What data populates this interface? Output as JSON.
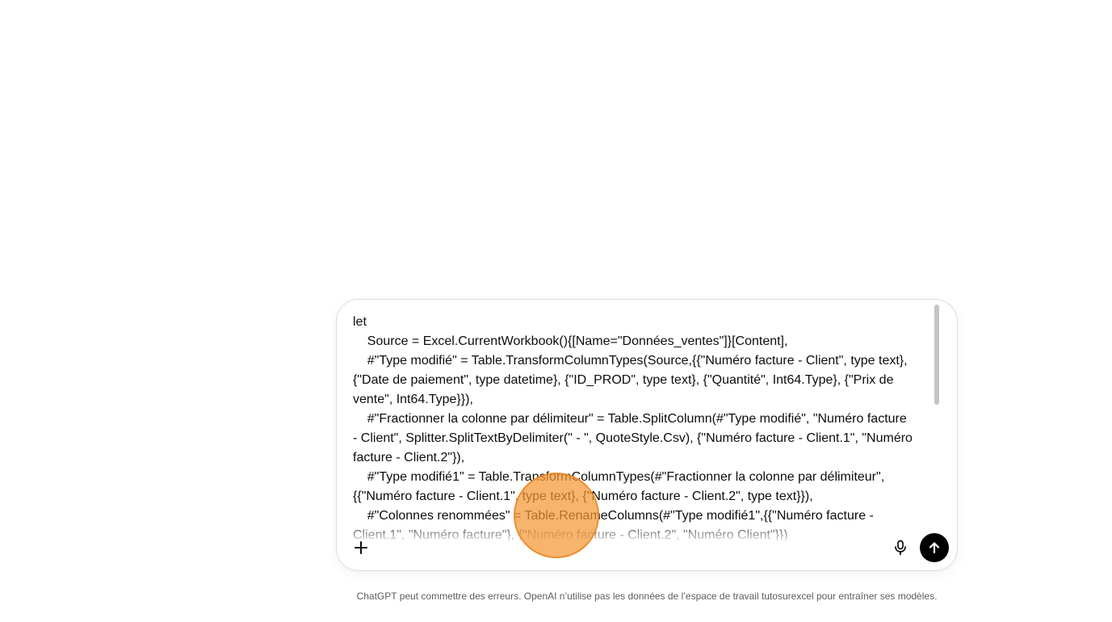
{
  "composer": {
    "prompt_lines": [
      "let",
      "    Source = Excel.CurrentWorkbook(){[Name=\"Données_ventes\"]}[Content],",
      "    #\"Type modifié\" = Table.TransformColumnTypes(Source,{{\"Numéro facture - Client\", type text},",
      "{\"Date de paiement\", type datetime}, {\"ID_PROD\", type text}, {\"Quantité\", Int64.Type}, {\"Prix de",
      "vente\", Int64.Type}}),",
      "    #\"Fractionner la colonne par délimiteur\" = Table.SplitColumn(#\"Type modifié\", \"Numéro facture",
      "- Client\", Splitter.SplitTextByDelimiter(\" - \", QuoteStyle.Csv), {\"Numéro facture - Client.1\", \"Numéro",
      "facture - Client.2\"}),",
      "    #\"Type modifié1\" = Table.TransformColumnTypes(#\"Fractionner la colonne par délimiteur\",",
      "{{\"Numéro facture - Client.1\", type text}, {\"Numéro facture - Client.2\", type text}}),",
      "    #\"Colonnes renommées\" = Table.RenameColumns(#\"Type modifié1\",{{\"Numéro facture -",
      "Client.1\", \"Numéro facture\"}, {\"Numéro facture - Client.2\", \"Numéro Client\"}})"
    ],
    "add_icon": "plus-icon",
    "mic_icon": "microphone-icon",
    "send_icon": "arrow-up-icon"
  },
  "footer": {
    "disclaimer": "ChatGPT peut commettre des erreurs. OpenAI n’utilise pas les données de l’espace de travail tutosurexcel pour entraîner ses modèles."
  },
  "colors": {
    "send_button": "#000000",
    "cursor_highlight": "#f49733",
    "composer_border": "#dcdcdc",
    "disclaimer_text": "#5d5d5d"
  }
}
